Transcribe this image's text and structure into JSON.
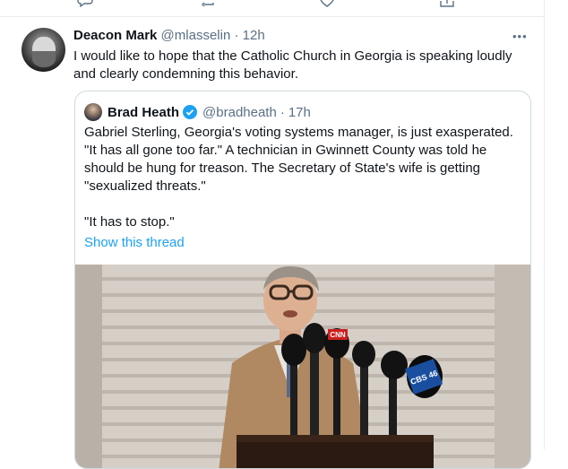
{
  "previous_tweet": {
    "actions": [
      "reply-icon",
      "retweet-icon",
      "like-icon",
      "share-icon"
    ]
  },
  "tweet": {
    "author_name": "Deacon Mark",
    "author_handle": "@mlasselin",
    "separator": "·",
    "time": "12h",
    "more": "•••",
    "text": "I would like to hope that the Catholic Church in Georgia is speaking loudly and clearly condemning this behavior."
  },
  "quoted": {
    "author_name": "Brad Heath",
    "author_handle": "@bradheath",
    "separator": "·",
    "time": "17h",
    "paragraph_1": "Gabriel Sterling, Georgia's voting systems manager, is just exasperated. \"It has all gone too far.\" A technician in Gwinnett County was told he should be hung for treason. The Secretary of State's wife is getting \"sexualized threats.\"",
    "paragraph_2": "\"It has to stop.\"",
    "show_thread": "Show this thread",
    "mic_flags": [
      "CNN",
      "CBS 46"
    ],
    "verified_color": "#1da1f2"
  },
  "colors": {
    "link": "#1da1f2",
    "secondary_text": "#5b7083",
    "border": "#cfd9de"
  }
}
